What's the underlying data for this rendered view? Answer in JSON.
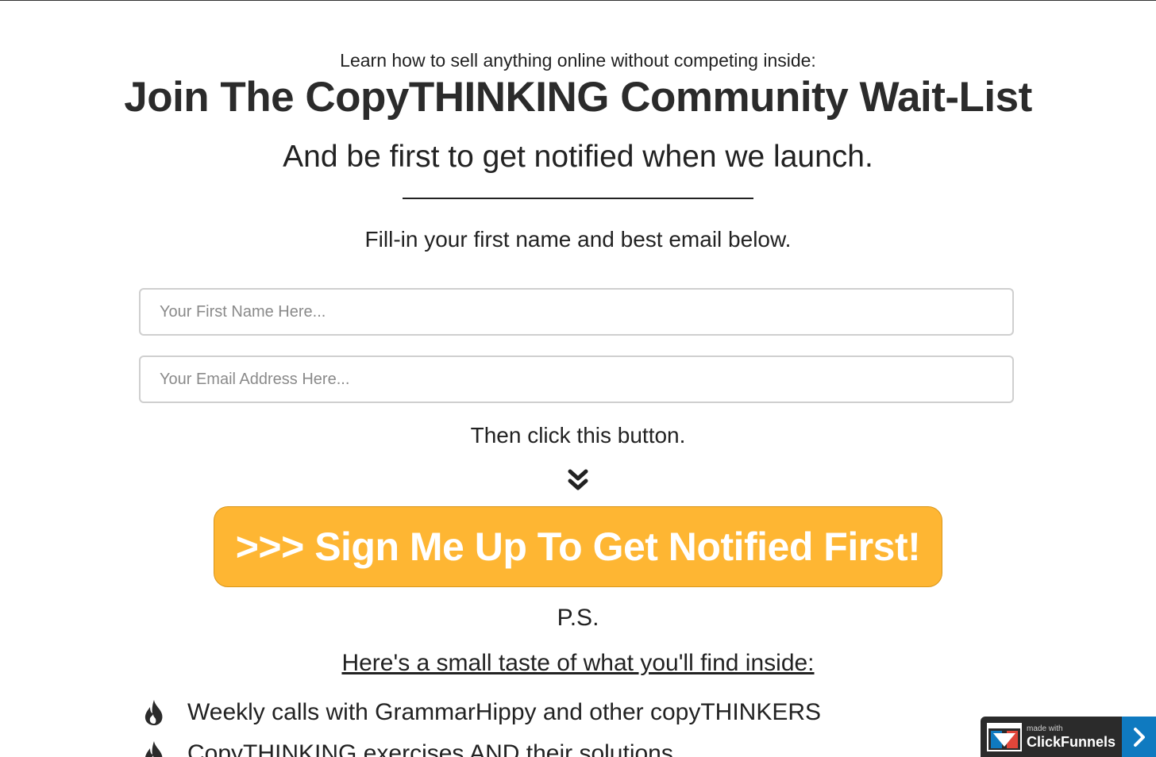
{
  "header": {
    "pre_headline": "Learn how to sell anything online without competing inside:",
    "headline": "Join The CopyTHINKING Community Wait-List",
    "subheadline": "And be first to get notified when we launch."
  },
  "form": {
    "instruction": "Fill-in your first name and best email below.",
    "first_name": {
      "value": "",
      "placeholder": "Your First Name Here..."
    },
    "email": {
      "value": "",
      "placeholder": "Your Email Address Here..."
    },
    "then_click": "Then click this button.",
    "submit_label": ">>> Sign Me Up To Get Notified First!"
  },
  "ps": {
    "label": "P.S.",
    "taste_link": "Here's a small taste of what you'll find inside:",
    "items": [
      {
        "icon": "flame-icon",
        "text": "Weekly calls with GrammarHippy and other copyTHINKERS"
      },
      {
        "icon": "flame-icon",
        "text": "CopyTHINKING exercises AND their solutions"
      }
    ]
  },
  "badge": {
    "made_with": "made with",
    "brand": "ClickFunnels"
  },
  "colors": {
    "cta_background": "#feb633",
    "cta_text": "#ffffff",
    "badge_background": "#2b2b2b",
    "badge_arrow": "#0f7ac0"
  }
}
